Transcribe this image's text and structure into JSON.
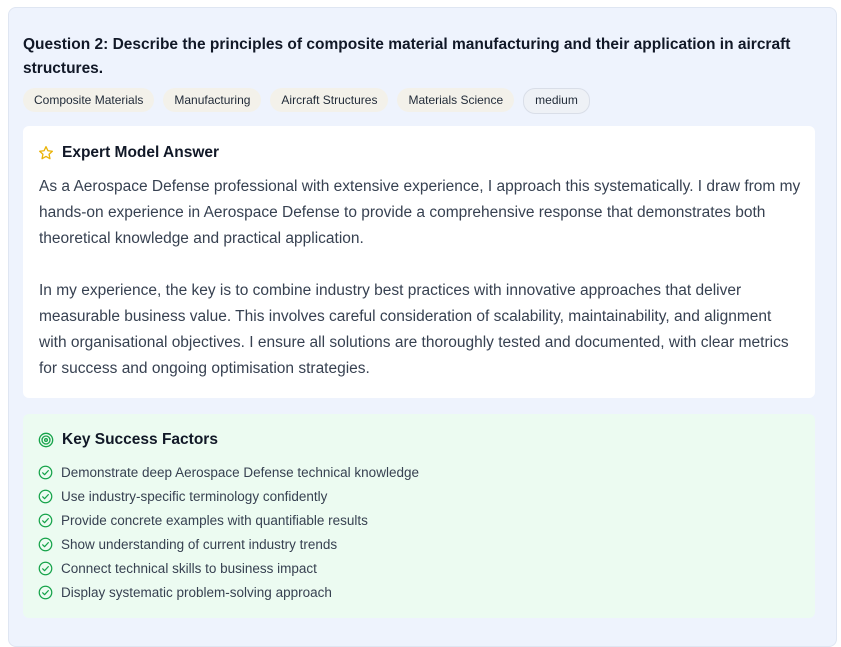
{
  "question": {
    "title": "Question 2: Describe the principles of composite material manufacturing and their application in aircraft structures."
  },
  "tags": [
    "Composite Materials",
    "Manufacturing",
    "Aircraft Structures",
    "Materials Science"
  ],
  "difficulty": "medium",
  "expert_answer": {
    "heading": "Expert Model Answer",
    "icon": "star-icon",
    "paragraphs": [
      "As a Aerospace Defense professional with extensive experience, I approach this systematically. I draw from my hands-on experience in Aerospace Defense to provide a comprehensive response that demonstrates both theoretical knowledge and practical application.",
      "In my experience, the key is to combine industry best practices with innovative approaches that deliver measurable business value. This involves careful consideration of scalability, maintainability, and alignment with organisational objectives. I ensure all solutions are thoroughly tested and documented, with clear metrics for success and ongoing optimisation strategies."
    ]
  },
  "success_factors": {
    "heading": "Key Success Factors",
    "icon": "target-icon",
    "item_icon": "check-circle-icon",
    "items": [
      "Demonstrate deep Aerospace Defense technical knowledge",
      "Use industry-specific terminology confidently",
      "Provide concrete examples with quantifiable results",
      "Show understanding of current industry trends",
      "Connect technical skills to business impact",
      "Display systematic problem-solving approach"
    ]
  },
  "colors": {
    "star": "#eab308",
    "target": "#16a34a",
    "check": "#16a34a",
    "card_bg": "#eef3fd",
    "factors_bg": "#ecfbf1"
  }
}
